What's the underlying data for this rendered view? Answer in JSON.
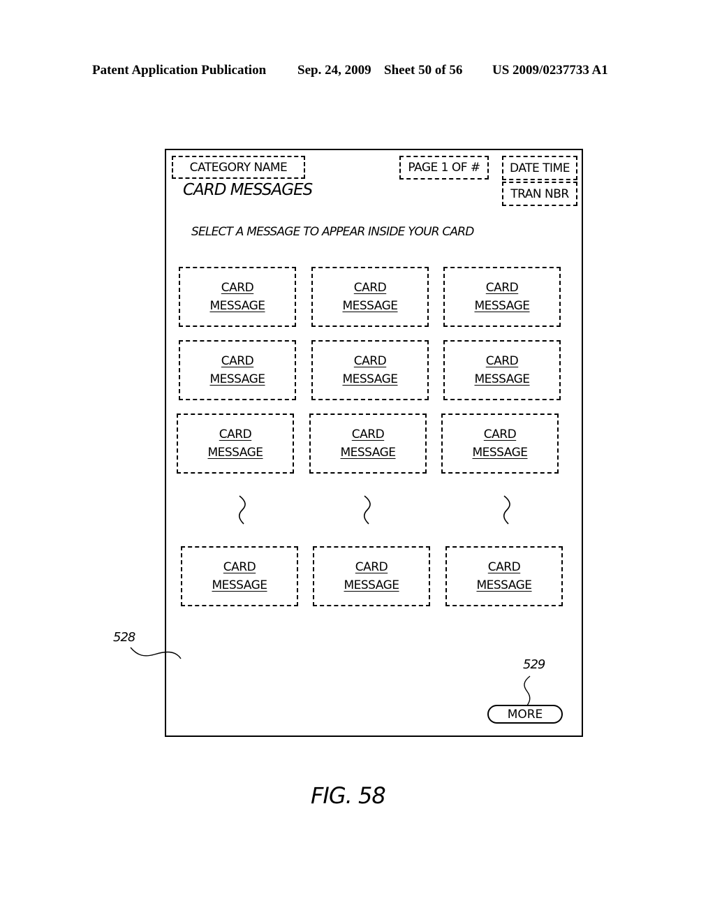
{
  "patent_header": {
    "publication": "Patent Application Publication",
    "date": "Sep. 24, 2009",
    "sheet": "Sheet 50 of 56",
    "number": "US 2009/0237733 A1"
  },
  "screen": {
    "category_name": "CATEGORY NAME",
    "page_indicator": "PAGE 1 OF #",
    "date_time": "DATE TIME",
    "tran_nbr": "TRAN NBR",
    "title": "CARD MESSAGES",
    "instruction": "SELECT A MESSAGE TO APPEAR INSIDE YOUR CARD",
    "cards": [
      {
        "line1": "CARD",
        "line2": "MESSAGE"
      },
      {
        "line1": "CARD",
        "line2": "MESSAGE"
      },
      {
        "line1": "CARD",
        "line2": "MESSAGE"
      },
      {
        "line1": "CARD",
        "line2": "MESSAGE"
      },
      {
        "line1": "CARD",
        "line2": "MESSAGE"
      },
      {
        "line1": "CARD",
        "line2": "MESSAGE"
      },
      {
        "line1": "CARD",
        "line2": "MESSAGE"
      },
      {
        "line1": "CARD",
        "line2": "MESSAGE"
      },
      {
        "line1": "CARD",
        "line2": "MESSAGE"
      },
      {
        "line1": "CARD",
        "line2": "MESSAGE"
      },
      {
        "line1": "CARD",
        "line2": "MESSAGE"
      },
      {
        "line1": "CARD",
        "line2": "MESSAGE"
      }
    ],
    "more_button": "MORE"
  },
  "reference_numerals": {
    "screen": "528",
    "more_button": "529"
  },
  "figure_label": "FIG. 58"
}
